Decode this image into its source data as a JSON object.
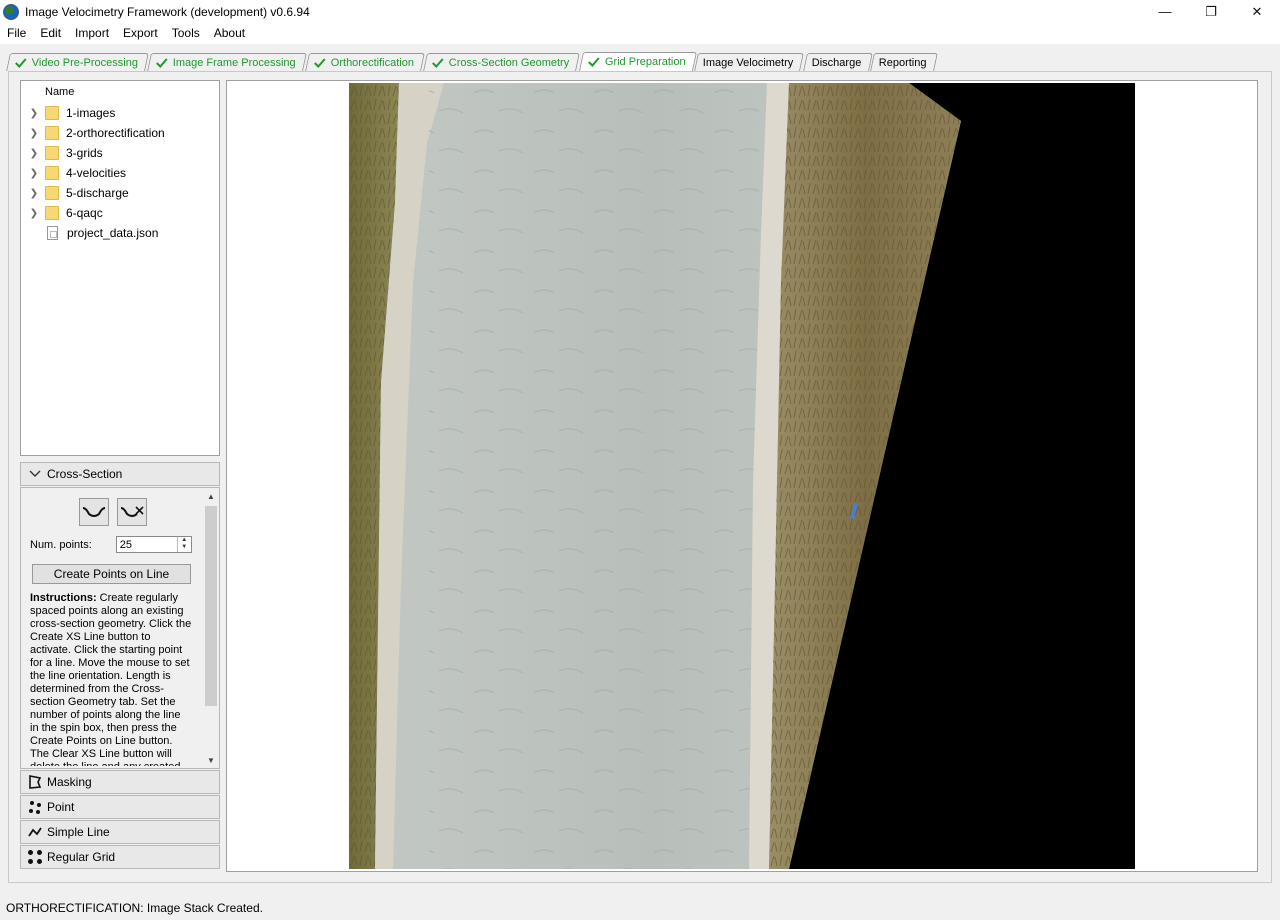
{
  "window": {
    "title": "Image Velocimetry Framework (development) v0.6.94",
    "minimize": "—",
    "restore": "❐",
    "close": "✕"
  },
  "menu": [
    "File",
    "Edit",
    "Import",
    "Export",
    "Tools",
    "About"
  ],
  "tabs": [
    {
      "label": "Video Pre-Processing",
      "done": true
    },
    {
      "label": "Image Frame Processing",
      "done": true
    },
    {
      "label": "Orthorectification",
      "done": true
    },
    {
      "label": "Cross-Section Geometry",
      "done": true
    },
    {
      "label": "Grid Preparation",
      "done": true,
      "active": true
    },
    {
      "label": "Image Velocimetry",
      "done": false
    },
    {
      "label": "Discharge",
      "done": false
    },
    {
      "label": "Reporting",
      "done": false
    }
  ],
  "tree": {
    "header": "Name",
    "items": [
      {
        "label": "1-images",
        "type": "folder"
      },
      {
        "label": "2-orthorectification",
        "type": "folder"
      },
      {
        "label": "3-grids",
        "type": "folder"
      },
      {
        "label": "4-velocities",
        "type": "folder"
      },
      {
        "label": "5-discharge",
        "type": "folder"
      },
      {
        "label": "6-qaqc",
        "type": "folder"
      },
      {
        "label": "project_data.json",
        "type": "file"
      }
    ]
  },
  "toolbox": {
    "cross_section": {
      "title": "Cross-Section",
      "num_points_label": "Num. points:",
      "num_points_value": "25",
      "create_button": "Create Points on Line",
      "instructions_bold": "Instructions:",
      "instructions_text": " Create regularly spaced points along an existing cross-section geometry. Click the Create XS Line button to activate. Click the starting point for a line. Move the mouse to set the line orientation. Length is determined from the Cross-section Geometry tab. Set the number of points along the line in the spin box, then press the Create Points on Line button. The Clear XS Line button will delete the line and any created points."
    },
    "masking": "Masking",
    "point": "Point",
    "simple_line": "Simple Line",
    "regular_grid": "Regular Grid"
  },
  "status": "ORTHORECTIFICATION: Image Stack Created.",
  "colors": {
    "tab_done": "#1e9a2e",
    "water": "#b8c0bc",
    "grass": "#8a7a4a"
  }
}
